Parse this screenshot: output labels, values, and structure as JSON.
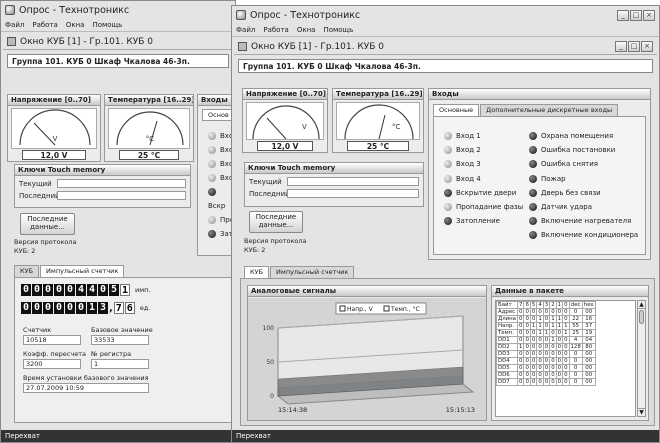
{
  "back": {
    "title": "Опрос - Технотроникс",
    "menu": [
      "Файл",
      "Работа",
      "Окна",
      "Помощь"
    ],
    "window_title": "Окно КУБ [1] -  Гр.101. КУБ 0",
    "group": "Группа 101.   КУБ 0 Шкаф Чкалова 46-3п.",
    "voltage_head": "Напряжение [0..70]",
    "temp_head": "Температура [16..29]",
    "inputs_head": "Входы",
    "voltage_val": "12,0 V",
    "temp_val": "25 °C",
    "tab_main": "Основ",
    "inputs": [
      "Вхо",
      "Вхо",
      "Вхо",
      "Вхо",
      "Вскр",
      "Про",
      "Зат"
    ],
    "keys_head": "Ключи Touch memory",
    "current_label": "Текущий",
    "last_label": "Последний",
    "last_data_btn": "Последние данные...",
    "protocol": "Версия протокола",
    "protocol_val": "КУБ: 2",
    "tabs": [
      "КУБ",
      "Импульсный счетчик"
    ],
    "counter1": {
      "digits": [
        "0",
        "0",
        "0",
        "0",
        "0",
        "4",
        "4",
        "0",
        "5"
      ],
      "last": "1",
      "unit": "имп."
    },
    "counter2": {
      "digits": [
        "0",
        "0",
        "0",
        "0",
        "0",
        "0",
        "1",
        "3"
      ],
      "sep": ",",
      "frac": [
        "7",
        "6"
      ],
      "unit": "ед."
    },
    "counter_label": "Счетчик",
    "counter_val": "10518",
    "base_label": "Базовое значение",
    "base_val": "33533",
    "coef_label": "Коэфф. пересчета",
    "coef_val": "3200",
    "reg_label": "№ регистра",
    "reg_val": "1",
    "time_label": "Время установки базового значения",
    "time_val": "27.07.2009 10:59",
    "status": "Перехват"
  },
  "front": {
    "title": "Опрос - Технотроникс",
    "menu": [
      "Файл",
      "Работа",
      "Окна",
      "Помощь"
    ],
    "window_title": "Окно КУБ [1] -  Гр.101. КУБ 0",
    "group": "Группа 101.   КУБ 0 Шкаф Чкалова 46-3п.",
    "voltage_head": "Напряжение [0..70]",
    "temp_head": "Температура [16..29]",
    "inputs_head": "Входы",
    "voltage_val": "12,0 V",
    "temp_val": "25 °C",
    "voltage_unit": "V",
    "temp_unit": "°C",
    "input_tabs": [
      "Основные",
      "Дополнительные дискретные входы"
    ],
    "inputs_left": [
      {
        "label": "Вход 1",
        "state": "off"
      },
      {
        "label": "Вход 2",
        "state": "off"
      },
      {
        "label": "Вход 3",
        "state": "off"
      },
      {
        "label": "Вход 4",
        "state": "off"
      },
      {
        "label": "Вскрытие двери",
        "state": "on"
      },
      {
        "label": "Пропадание фазы",
        "state": "off"
      },
      {
        "label": "Затопление",
        "state": "on"
      }
    ],
    "inputs_right": [
      {
        "label": "Охрана помещения",
        "state": "on"
      },
      {
        "label": "Ошибка постановки",
        "state": "on"
      },
      {
        "label": "Ошибка снятия",
        "state": "on"
      },
      {
        "label": "Пожар",
        "state": "on"
      },
      {
        "label": "Дверь без связи",
        "state": "on"
      },
      {
        "label": "Датчик удара",
        "state": "on"
      },
      {
        "label": "Включение нагревателя",
        "state": "on"
      },
      {
        "label": "Включение кондиционера",
        "state": "on"
      }
    ],
    "keys_head": "Ключи Touch memory",
    "current_label": "Текущий",
    "last_label": "Последний",
    "last_data_btn": "Последние данные...",
    "protocol": "Версия протокола",
    "protocol_val": "КУБ: 2",
    "tabs": [
      "КУБ",
      "Импульсный счетчик"
    ],
    "analog_head": "Аналоговые сигналы",
    "packet_head": "Данные в пакете",
    "status": "Перехват"
  },
  "chart_data": {
    "type": "area",
    "title": "Аналоговые сигналы",
    "legend": [
      "Напр., V",
      "Темп., °C"
    ],
    "x": [
      "15:14:38",
      "15:15:13"
    ],
    "ylim": [
      0,
      100
    ],
    "yticks": [
      "100",
      "50",
      "0"
    ],
    "series": [
      {
        "name": "Напр., V",
        "values": [
          12,
          12,
          12,
          12,
          12,
          12,
          12,
          12,
          12,
          12
        ]
      },
      {
        "name": "Темп., °C",
        "values": [
          25,
          25,
          25,
          25,
          25,
          25,
          25,
          25,
          25,
          25
        ]
      }
    ]
  },
  "packet_table": {
    "header": [
      "Байт",
      "7",
      "6",
      "5",
      "4",
      "3",
      "2",
      "1",
      "0",
      "dec",
      "hex"
    ],
    "rows": [
      [
        "Адрес",
        "0",
        "0",
        "0",
        "0",
        "0",
        "0",
        "0",
        "0",
        "0",
        "00"
      ],
      [
        "Длина",
        "0",
        "0",
        "0",
        "1",
        "0",
        "1",
        "1",
        "0",
        "22",
        "16"
      ],
      [
        "Напр.",
        "0",
        "0",
        "1",
        "1",
        "0",
        "1",
        "1",
        "1",
        "55",
        "37"
      ],
      [
        "Темп.",
        "0",
        "0",
        "0",
        "1",
        "1",
        "0",
        "0",
        "1",
        "25",
        "19"
      ],
      [
        "DD1",
        "0",
        "0",
        "0",
        "0",
        "0",
        "1",
        "0",
        "0",
        "4",
        "04"
      ],
      [
        "DD2",
        "1",
        "0",
        "0",
        "0",
        "0",
        "0",
        "0",
        "0",
        "128",
        "80"
      ],
      [
        "DD3",
        "0",
        "0",
        "0",
        "0",
        "0",
        "0",
        "0",
        "0",
        "0",
        "00"
      ],
      [
        "DD4",
        "0",
        "0",
        "0",
        "0",
        "0",
        "0",
        "0",
        "0",
        "0",
        "00"
      ],
      [
        "DD5",
        "0",
        "0",
        "0",
        "0",
        "0",
        "0",
        "0",
        "0",
        "0",
        "00"
      ],
      [
        "DD6",
        "0",
        "0",
        "0",
        "0",
        "0",
        "0",
        "0",
        "0",
        "0",
        "00"
      ],
      [
        "DD7",
        "0",
        "0",
        "0",
        "0",
        "0",
        "0",
        "0",
        "0",
        "0",
        "00"
      ]
    ]
  }
}
